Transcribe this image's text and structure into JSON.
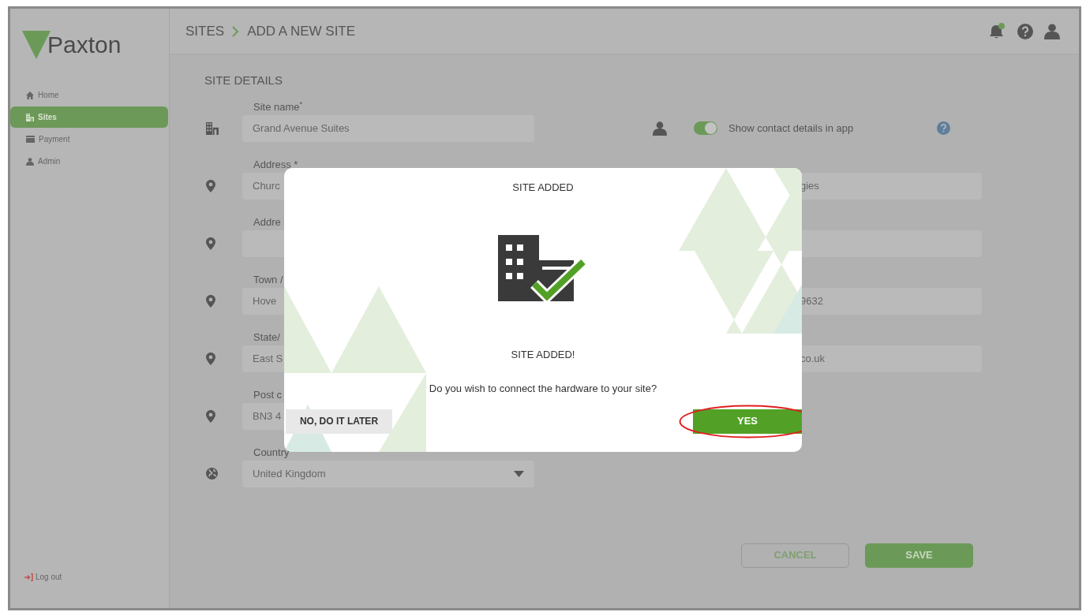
{
  "logo": {
    "text": "Paxton"
  },
  "breadcrumb": [
    "SITES",
    "ADD A NEW SITE"
  ],
  "sidebar": {
    "items": [
      {
        "label": "Home",
        "selected": false
      },
      {
        "label": "Sites",
        "selected": true
      },
      {
        "label": "Payment",
        "selected": false
      },
      {
        "label": "Admin",
        "selected": false
      }
    ],
    "logout": "Log out"
  },
  "section_title": "SITE DETAILS",
  "left_fields": [
    {
      "label": "Site name$^{*}$",
      "value": "Grand Avenue Suites",
      "kind": "text"
    },
    {
      "label": "Address *",
      "value": "Churc",
      "kind": "text"
    },
    {
      "label": "Addre",
      "kind": "text"
    },
    {
      "label": "Town /",
      "value": "Hove",
      "kind": "text"
    },
    {
      "label": "State/",
      "value": "East S",
      "kind": "text"
    },
    {
      "label": "Post c",
      "value": "BN3 4",
      "kind": "text"
    },
    {
      "label": "Country",
      "value": "United Kingdom",
      "kind": "select"
    }
  ],
  "contact_toggle": {
    "label": "Show contact details in app",
    "on": true
  },
  "right_fields": [
    {
      "value": "gies",
      "kind": "text"
    },
    {
      "kind": "text"
    },
    {
      "value": "9632",
      "kind": "text"
    },
    {
      "value": "co.uk",
      "kind": "text"
    }
  ],
  "buttons": [
    {
      "label": "CANCEL",
      "kind": "outline"
    },
    {
      "label": "SAVE",
      "kind": "primary"
    }
  ],
  "dialog": {
    "title": "SITE ADDED",
    "heading": "SITE ADDED!",
    "message": "Do you wish to connect the hardware to your site?",
    "buttons": [
      {
        "label": "NO, DO IT LATER",
        "kind": "secondary",
        "highlighted": false
      },
      {
        "label": "YES",
        "kind": "primary",
        "highlighted": true
      }
    ]
  }
}
